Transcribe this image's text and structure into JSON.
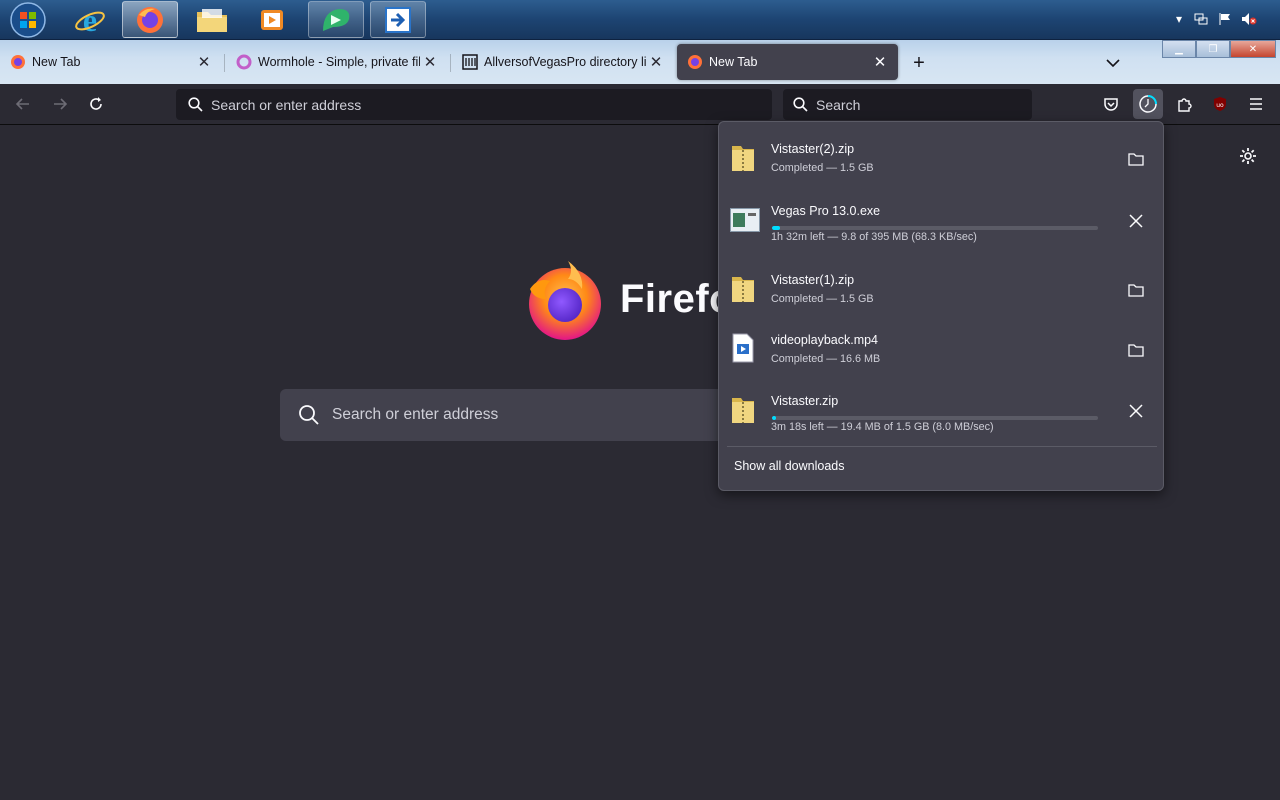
{
  "taskbar": {
    "apps": [
      {
        "name": "start-orb",
        "icon": "windows-orb-icon"
      },
      {
        "name": "internet-explorer",
        "icon": "internet-explorer-icon"
      },
      {
        "name": "firefox",
        "icon": "firefox-icon",
        "state": "active"
      },
      {
        "name": "file-explorer",
        "icon": "folder-icon"
      },
      {
        "name": "media-player",
        "icon": "media-player-icon"
      },
      {
        "name": "app-green",
        "icon": "green-app-icon",
        "state": "open"
      },
      {
        "name": "app-arrow",
        "icon": "arrow-app-icon",
        "state": "open"
      }
    ]
  },
  "tabs": [
    {
      "label": "New Tab",
      "icon": "firefox-icon",
      "close": "✕"
    },
    {
      "label": "Wormhole - Simple, private file",
      "icon": "wormhole-icon",
      "close": "✕"
    },
    {
      "label": "AllversofVegasPro directory listi",
      "icon": "archive-icon",
      "close": "✕"
    },
    {
      "label": "New Tab",
      "icon": "firefox-icon",
      "close": "✕",
      "selected": true
    }
  ],
  "tabstrip": {
    "new_tab": "+",
    "list_all": "⌄"
  },
  "nav": {
    "url_placeholder": "Search or enter address",
    "search_placeholder": "Search"
  },
  "content": {
    "wordmark": "Firefo",
    "search_placeholder": "Search or enter address"
  },
  "downloads": {
    "items": [
      {
        "name": "Vistaster(2).zip",
        "status": "Completed — 1.5 GB",
        "icon": "zip-folder-icon",
        "action": "folder-icon"
      },
      {
        "name": "Vegas Pro 13.0.exe",
        "status": "1h 32m left — 9.8 of 395 MB (68.3 KB/sec)",
        "icon": "exe-icon",
        "action": "cancel-icon",
        "progress": 0.025
      },
      {
        "name": "Vistaster(1).zip",
        "status": "Completed — 1.5 GB",
        "icon": "zip-folder-icon",
        "action": "folder-icon"
      },
      {
        "name": "videoplayback.mp4",
        "status": "Completed — 16.6 MB",
        "icon": "video-file-icon",
        "action": "folder-icon"
      },
      {
        "name": "Vistaster.zip",
        "status": "3m 18s left — 19.4 MB of 1.5 GB (8.0 MB/sec)",
        "icon": "zip-folder-icon",
        "action": "cancel-icon",
        "progress": 0.013
      }
    ],
    "show_all": "Show all downloads"
  },
  "colors": {
    "accent": "#00ddff",
    "panel": "#42414d",
    "toolbar": "#2b2a33"
  }
}
